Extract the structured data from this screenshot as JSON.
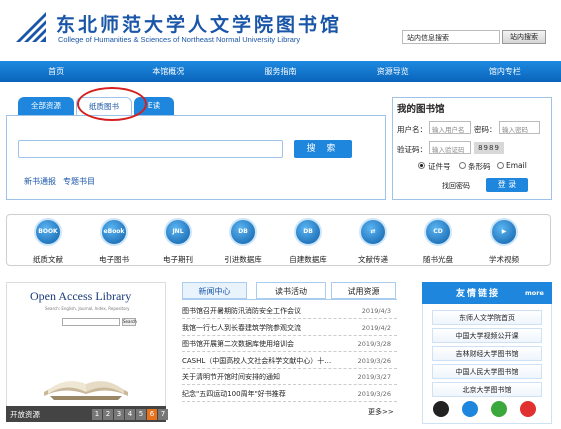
{
  "header": {
    "title_cn": "东北师范大学人文学院图书馆",
    "title_en": "College of Humanities & Sciences of Northeast Normal University Library",
    "site_search_placeholder": "站内信息搜索",
    "site_search_button": "站内搜索"
  },
  "nav": [
    "首页",
    "本馆概况",
    "服务指南",
    "资源导览",
    "馆内专栏"
  ],
  "search": {
    "tabs": [
      "全部资源",
      "纸质图书",
      "E读"
    ],
    "button": "搜 索",
    "links": [
      "新书通报",
      "专题书目"
    ]
  },
  "library": {
    "title": "我的图书馆",
    "user_label": "用户名：",
    "user_placeholder": "输入用户名",
    "pass_label": "密码：",
    "pass_placeholder": "输入密码",
    "captcha_label": "验证码：",
    "captcha_placeholder": "输入验证码",
    "captcha_value": "8989",
    "radios": [
      "证件号",
      "条形码",
      "Email"
    ],
    "forgot": "找回密码",
    "login": "登 录"
  },
  "quick_links": [
    {
      "label": "纸质文献",
      "icon": "book-stack-icon",
      "glyph": "BOOK"
    },
    {
      "label": "电子图书",
      "icon": "ebook-icon",
      "glyph": "eBook"
    },
    {
      "label": "电子期刊",
      "icon": "journal-icon",
      "glyph": "JNL"
    },
    {
      "label": "引进数据库",
      "icon": "database-icon",
      "glyph": "DB"
    },
    {
      "label": "自建数据库",
      "icon": "server-icon",
      "glyph": "DB"
    },
    {
      "label": "文献传递",
      "icon": "transfer-icon",
      "glyph": "⇄"
    },
    {
      "label": "随书光盘",
      "icon": "disc-icon",
      "glyph": "CD"
    },
    {
      "label": "学术视频",
      "icon": "video-icon",
      "glyph": "▶"
    }
  ],
  "open_access": {
    "title": "Open Access Library",
    "subtitle": "Search: English, Journal, Index, Repository",
    "button": "Search",
    "label": "开放资源",
    "pages": [
      "1",
      "2",
      "3",
      "4",
      "5",
      "6",
      "7"
    ]
  },
  "news": {
    "tabs": [
      "新闻中心",
      "读书活动",
      "试用资源"
    ],
    "items": [
      {
        "title": "图书馆召开暑期防汛消防安全工作会议",
        "date": "2019/4/3"
      },
      {
        "title": "我馆一行七人到长春建筑学院参观交流",
        "date": "2019/4/2"
      },
      {
        "title": "图书馆开展第二次数据库使用培训会",
        "date": "2019/3/28"
      },
      {
        "title": "CASHL（中国高校人文社会科学文献中心）十…",
        "date": "2019/3/26"
      },
      {
        "title": "关于清明节开馆时间安排的通知",
        "date": "2019/3/27"
      },
      {
        "title": "纪念\"五四运动100周年\"好书推荐",
        "date": "2019/3/26"
      }
    ],
    "more": "更多>>"
  },
  "friends": {
    "title": "友情链接",
    "more": "more",
    "items": [
      "东师人文学院首页",
      "中国大学视频公开课",
      "吉林财经大学图书馆",
      "中国人民大学图书馆",
      "北京大学图书馆"
    ],
    "social_icons": [
      "qq-icon",
      "phone-icon",
      "wechat-icon",
      "weibo-icon"
    ]
  }
}
